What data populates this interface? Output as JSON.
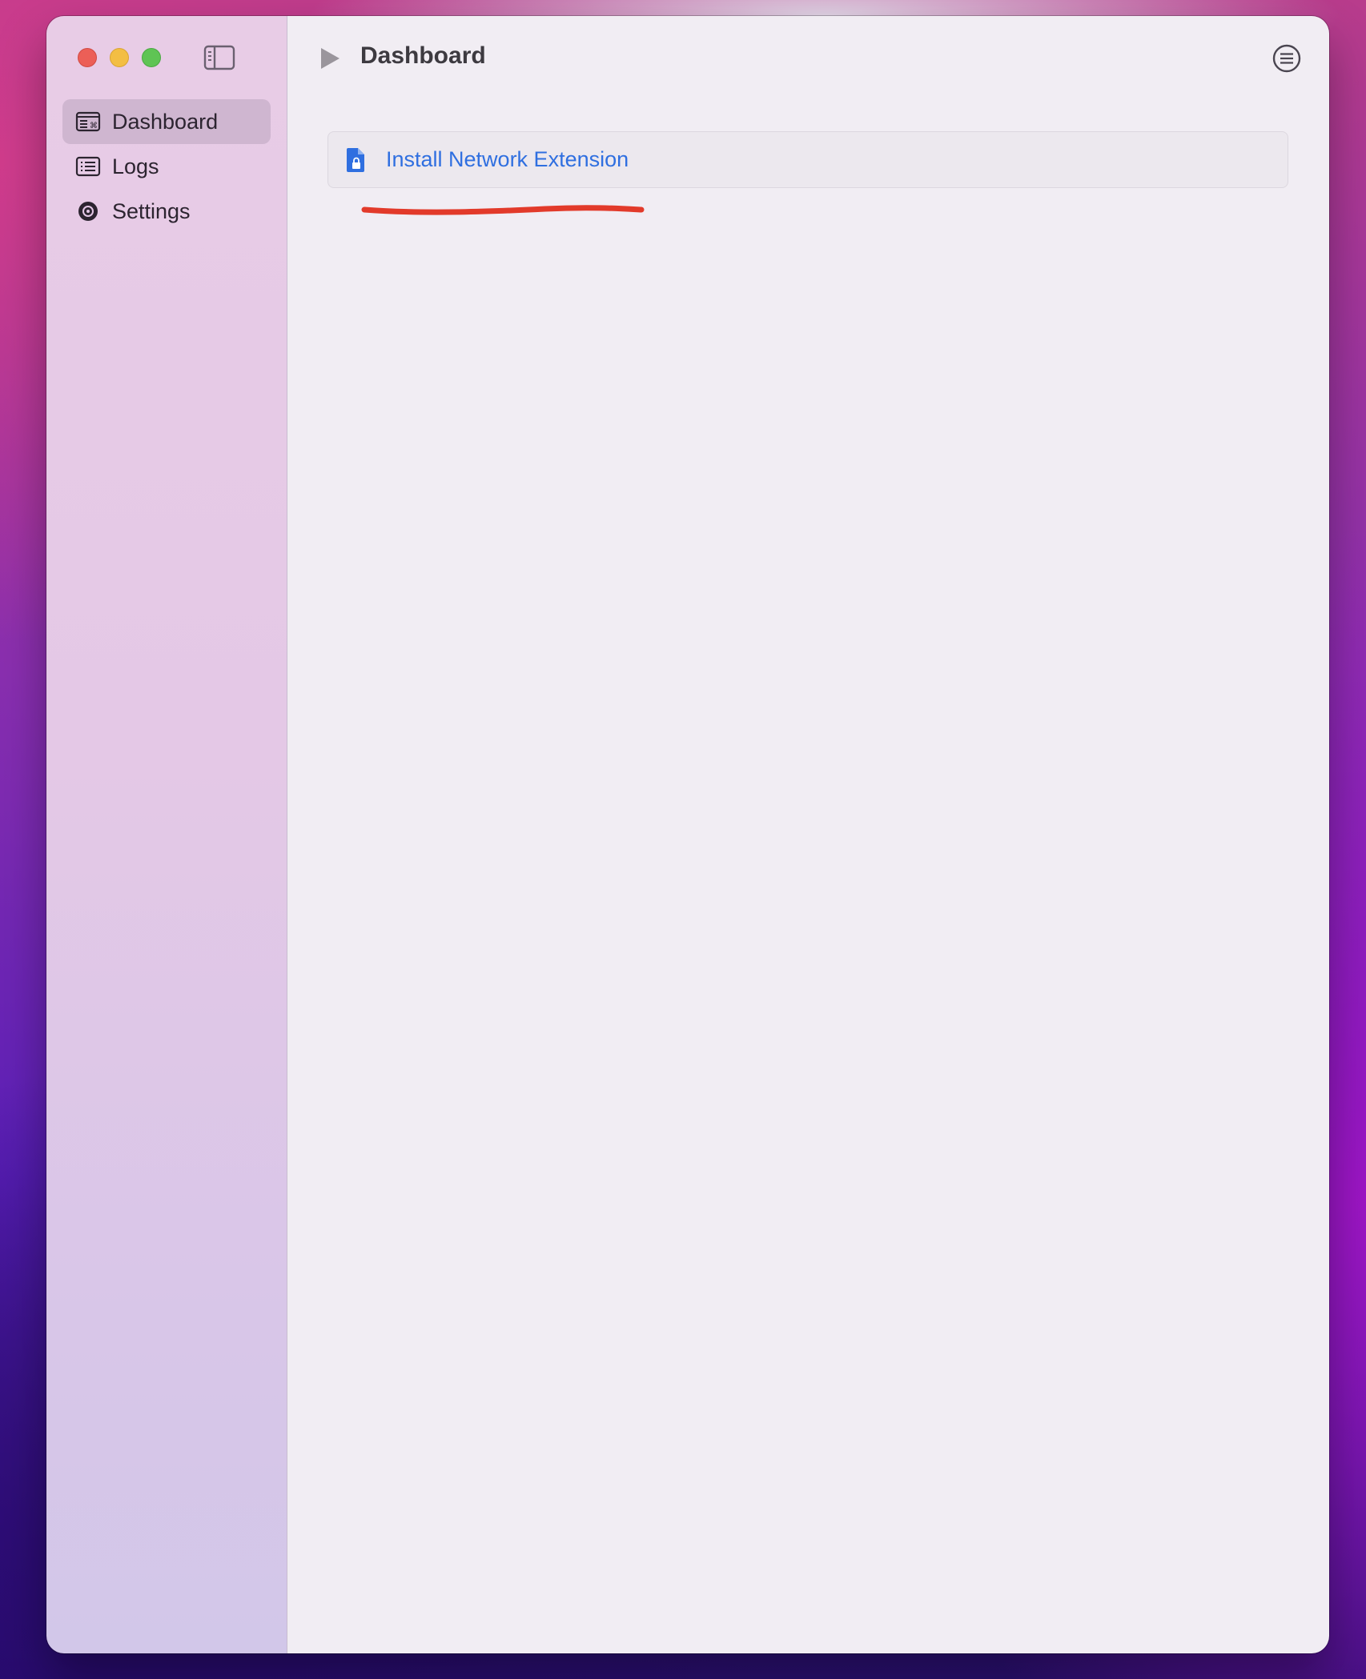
{
  "window": {
    "title": "Dashboard"
  },
  "sidebar": {
    "items": [
      {
        "label": "Dashboard",
        "icon": "dashboard-icon",
        "selected": true
      },
      {
        "label": "Logs",
        "icon": "list-icon",
        "selected": false
      },
      {
        "label": "Settings",
        "icon": "settings-icon",
        "selected": false
      }
    ]
  },
  "main": {
    "action": {
      "label": "Install Network Extension",
      "icon": "locked-document-icon"
    }
  },
  "colors": {
    "accent": "#2f6fe0",
    "annotation": "#e23a2a",
    "selection": "#cfb6d0"
  }
}
